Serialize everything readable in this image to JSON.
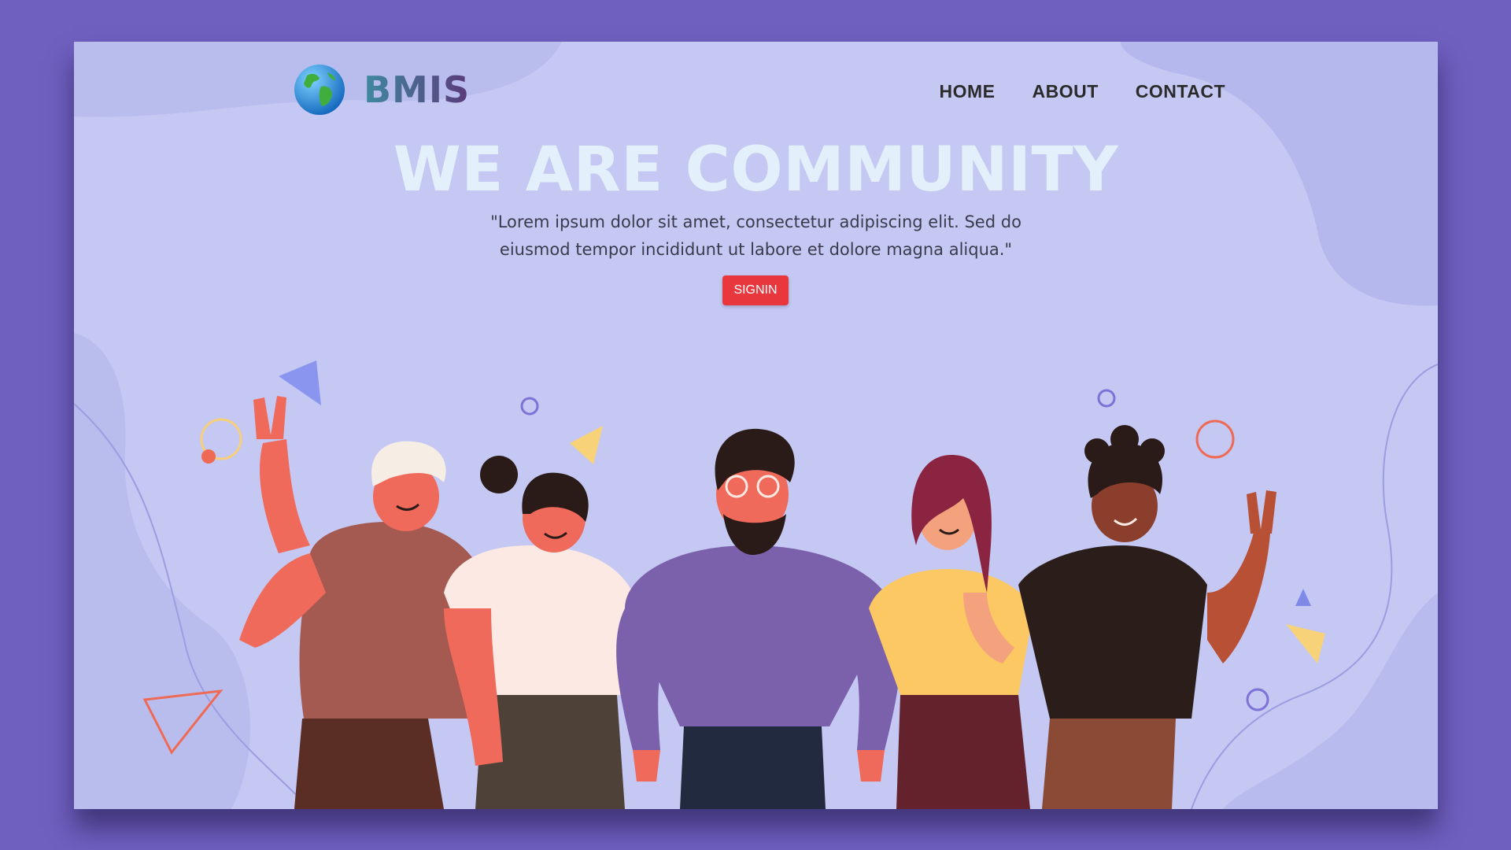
{
  "brand": {
    "name": "BMIS",
    "logo_icon": "globe-icon"
  },
  "nav": {
    "items": [
      {
        "label": "HOME"
      },
      {
        "label": "ABOUT"
      },
      {
        "label": "CONTACT"
      }
    ]
  },
  "hero": {
    "title": "WE ARE COMMUNITY",
    "text": "\"Lorem ipsum dolor sit amet, consectetur adipiscing elit. Sed do eiusmod tempor incididunt ut labore et dolore magna aliqua.\"",
    "button_label": "SIGNIN"
  },
  "colors": {
    "page_background": "#6f5fbf",
    "card_background": "#c4c8f2",
    "button": "#e8383e",
    "title": "#e3effa"
  }
}
